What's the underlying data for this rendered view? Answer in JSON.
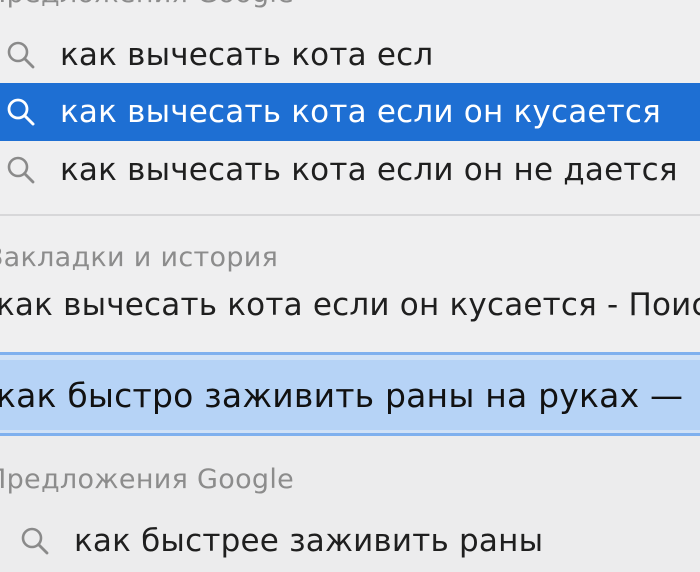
{
  "google_suggestions_top": {
    "header": "Предложения Google",
    "items": [
      {
        "label": "как вычесать кота есл",
        "selected": false,
        "icon": "search-icon"
      },
      {
        "label": "как вычесать кота если он кусается",
        "selected": true,
        "icon": "search-icon"
      },
      {
        "label": "как вычесать кота если он не дается",
        "selected": false,
        "icon": "search-icon"
      }
    ]
  },
  "bookmarks_history": {
    "header": "Закладки и история",
    "items": [
      {
        "label": "как вычесать кота если он кусается - Поиск в Google"
      }
    ]
  },
  "address_bar": {
    "value": "как быстро заживить раны на руках —"
  },
  "google_suggestions_bottom": {
    "header": "Предложения Google",
    "items": [
      {
        "label": "как быстрее заживить раны",
        "icon": "search-icon"
      }
    ]
  },
  "colors": {
    "selection": "#1e6fd3",
    "address_highlight": "#b6d3f6",
    "header_text": "#8c8c8c"
  }
}
